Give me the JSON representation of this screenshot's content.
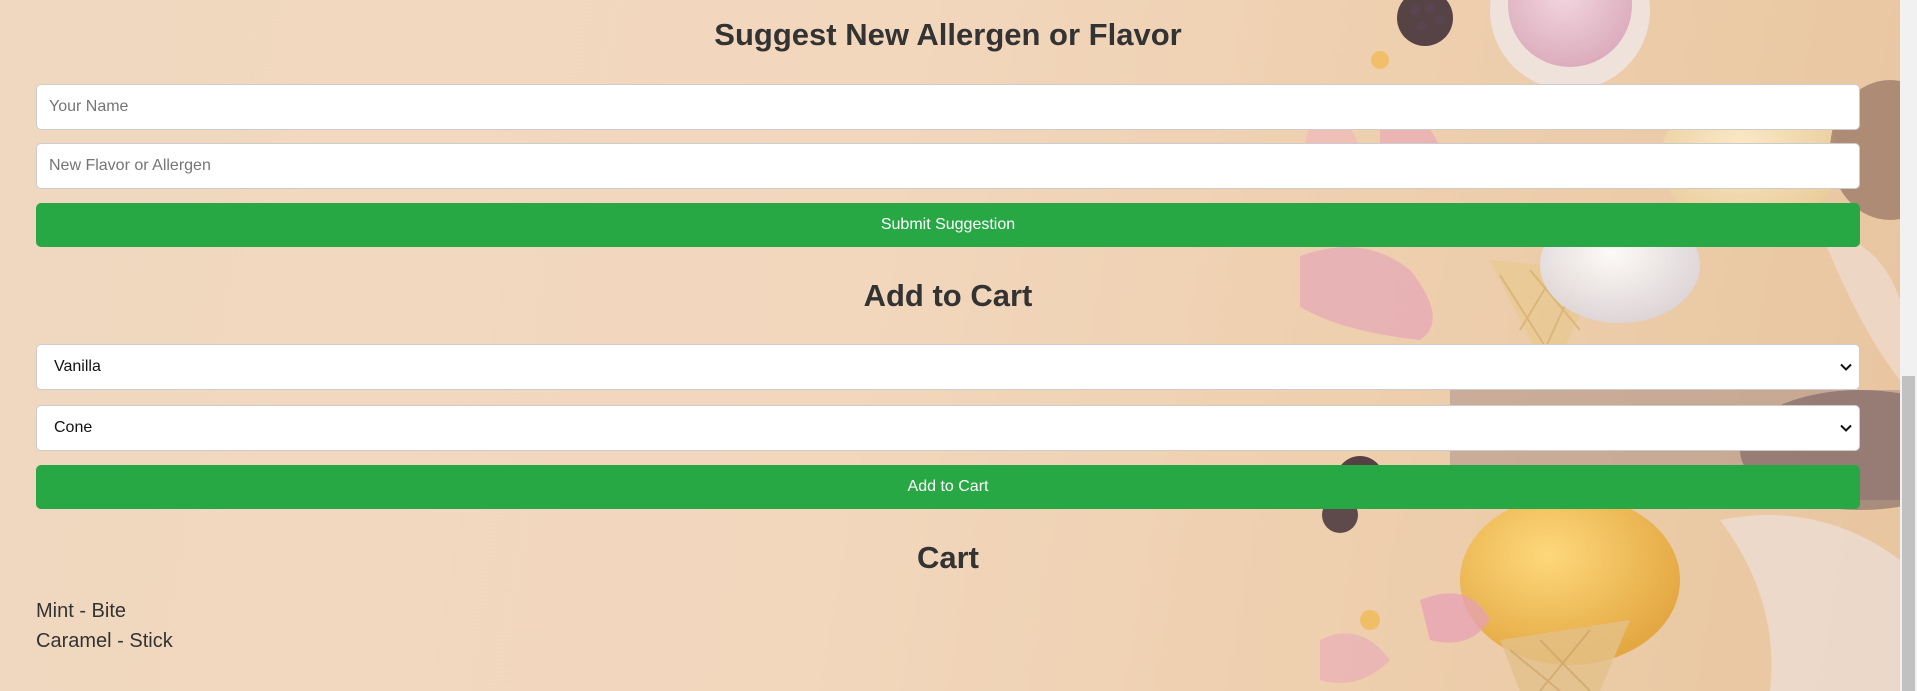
{
  "suggest_section": {
    "title": "Suggest New Allergen or Flavor",
    "name_placeholder": "Your Name",
    "flavor_placeholder": "New Flavor or Allergen",
    "submit_label": "Submit Suggestion"
  },
  "add_to_cart_section": {
    "title": "Add to Cart",
    "flavor_selected": "Vanilla",
    "container_selected": "Cone",
    "add_label": "Add to Cart"
  },
  "cart_section": {
    "title": "Cart",
    "items": [
      "Mint - Bite",
      "Caramel - Stick"
    ]
  },
  "colors": {
    "button": "#28a745",
    "text": "#333333",
    "background": "#f2d7bd"
  },
  "icons": {
    "select_arrow": "chevron-down-icon"
  }
}
